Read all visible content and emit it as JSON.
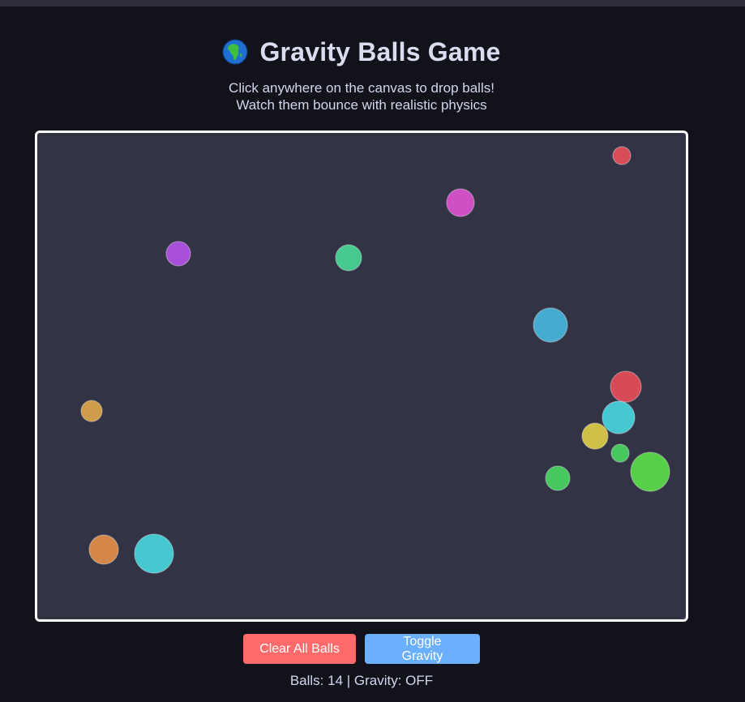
{
  "header": {
    "title": "Gravity Balls Game",
    "subtitle_line1": "Click anywhere on the canvas to drop balls!",
    "subtitle_line2": "Watch them bounce with realistic physics",
    "icon": "globe-africa-icon"
  },
  "controls": {
    "clear_label": "Clear All Balls",
    "toggle_label": "Toggle Gravity",
    "clear_color": "#ff6b6b",
    "toggle_color": "#6ab0ff"
  },
  "status": {
    "text": "Balls: 14 | Gravity: OFF",
    "ball_count": 14,
    "gravity": "OFF"
  },
  "canvas": {
    "background": "#323345",
    "balls": [
      {
        "color": "#e8505a"
      },
      {
        "color": "#e052d2"
      },
      {
        "color": "#b452e8"
      },
      {
        "color": "#48d896"
      },
      {
        "color": "#48b8e0"
      },
      {
        "color": "#e84e58"
      },
      {
        "color": "#e0a84a"
      },
      {
        "color": "#48d8e0"
      },
      {
        "color": "#e0d048"
      },
      {
        "color": "#48d860"
      },
      {
        "color": "#5ce048"
      },
      {
        "color": "#48d860"
      },
      {
        "color": "#e8904a"
      },
      {
        "color": "#48d8e0"
      }
    ]
  }
}
